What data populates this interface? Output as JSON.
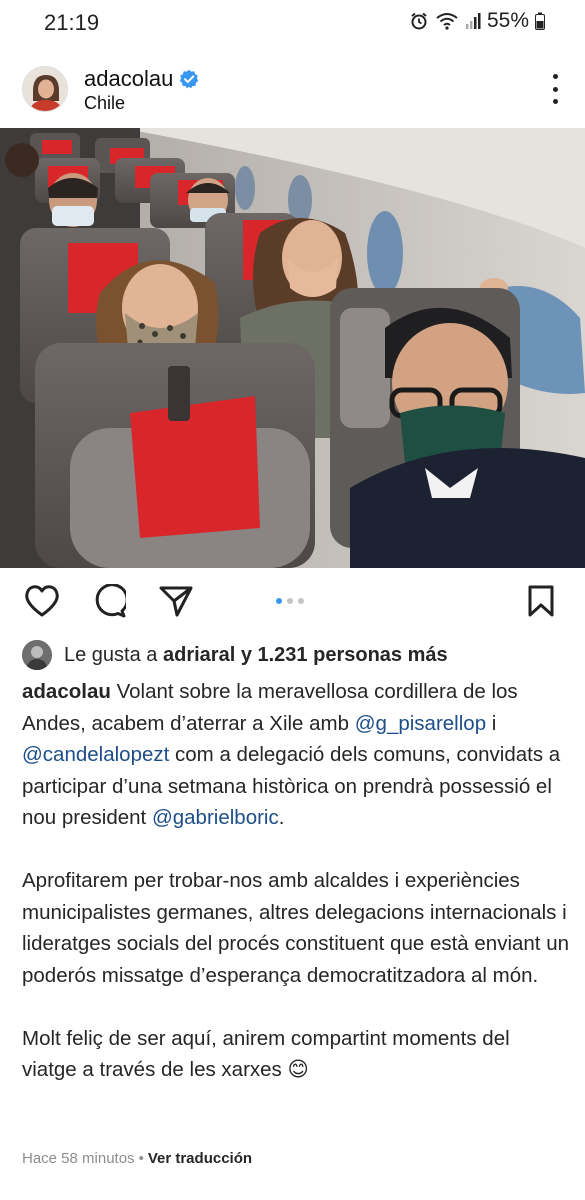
{
  "status_bar": {
    "time": "21:19",
    "battery": "55%",
    "icons": [
      "alarm-icon",
      "wifi-icon",
      "signal-icon",
      "battery-icon"
    ]
  },
  "post": {
    "username": "adacolau",
    "location": "Chile",
    "verified": true
  },
  "carousel": {
    "total": 3,
    "active": 0
  },
  "likes": {
    "prefix": "Le gusta a",
    "user": "adriaral",
    "joiner": "y",
    "count": "1.231 personas más"
  },
  "caption": {
    "username": "adacolau",
    "p1_a": "Volant sobre la meravellosa cordillera de los Andes, acabem d’aterrar a Xile amb",
    "mention_1": "@g_pisarellop",
    "p1_b": "i",
    "mention_2": "@candelalopezt",
    "p1_c": "com a delegació dels comuns, convidats a participar d’una setmana històrica on prendrà possessió el nou president",
    "mention_3": "@gabrielboric",
    "p1_d": ".",
    "p2": "Aprofitarem per trobar-nos amb alcaldes i experiències municipalistes germanes, altres delegacions internacionals i lideratges socials del procés constituent que està enviant un poderós missatge d’esperança democratitzadora al món.",
    "p3": "Molt feliç de ser aquí, anirem compartint moments del viatge a través de les xarxes",
    "emoji": "😊"
  },
  "meta": {
    "time_ago": "Hace 58 minutos",
    "separator": "•",
    "translate": "Ver traducción"
  },
  "colors": {
    "mention": "#1d4e89",
    "verified": "#3897f0",
    "seat_red": "#d8262b"
  }
}
